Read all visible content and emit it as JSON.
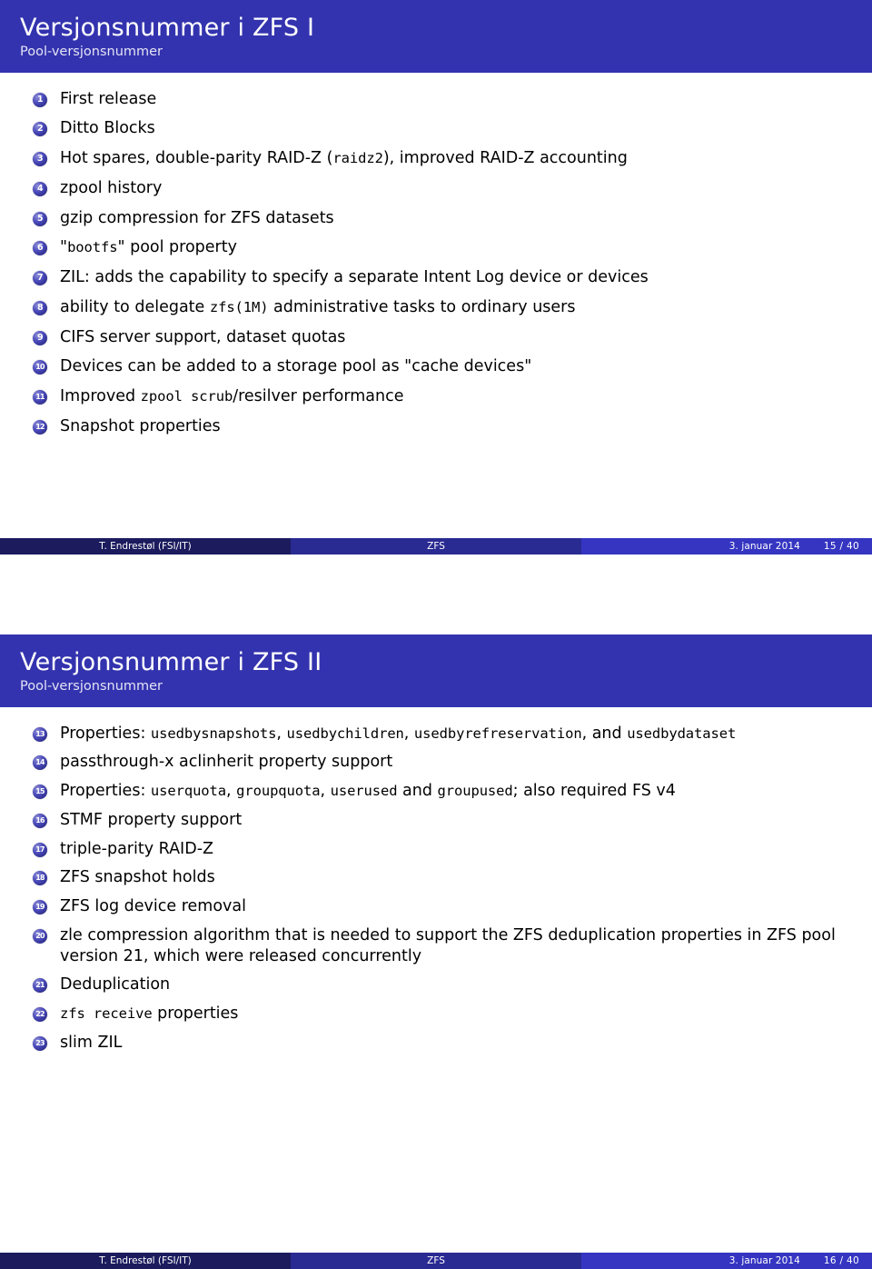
{
  "slides": [
    {
      "title": "Versjonsnummer i ZFS I",
      "subtitle": "Pool-versjonsnummer",
      "items": [
        {
          "n": "1",
          "parts": [
            {
              "t": "First release",
              "mono": false
            }
          ]
        },
        {
          "n": "2",
          "parts": [
            {
              "t": "Ditto Blocks",
              "mono": false
            }
          ]
        },
        {
          "n": "3",
          "parts": [
            {
              "t": "Hot spares, double-parity RAID-Z (",
              "mono": false
            },
            {
              "t": "raidz2",
              "mono": true
            },
            {
              "t": "), improved RAID-Z accounting",
              "mono": false
            }
          ]
        },
        {
          "n": "4",
          "parts": [
            {
              "t": "zpool history",
              "mono": false
            }
          ]
        },
        {
          "n": "5",
          "parts": [
            {
              "t": "gzip compression for ZFS datasets",
              "mono": false
            }
          ]
        },
        {
          "n": "6",
          "parts": [
            {
              "t": "\"",
              "mono": false
            },
            {
              "t": "bootfs",
              "mono": true
            },
            {
              "t": "\" pool property",
              "mono": false
            }
          ]
        },
        {
          "n": "7",
          "parts": [
            {
              "t": "ZIL: adds the capability to specify a separate Intent Log device or devices",
              "mono": false
            }
          ]
        },
        {
          "n": "8",
          "parts": [
            {
              "t": "ability to delegate ",
              "mono": false
            },
            {
              "t": "zfs(1M)",
              "mono": true
            },
            {
              "t": " administrative tasks to ordinary users",
              "mono": false
            }
          ]
        },
        {
          "n": "9",
          "parts": [
            {
              "t": "CIFS server support, dataset quotas",
              "mono": false
            }
          ]
        },
        {
          "n": "10",
          "parts": [
            {
              "t": "Devices can be added to a storage pool as \"cache devices\"",
              "mono": false
            }
          ]
        },
        {
          "n": "11",
          "parts": [
            {
              "t": "Improved ",
              "mono": false
            },
            {
              "t": "zpool scrub",
              "mono": true
            },
            {
              "t": "/resilver performance",
              "mono": false
            }
          ]
        },
        {
          "n": "12",
          "parts": [
            {
              "t": "Snapshot properties",
              "mono": false
            }
          ]
        }
      ],
      "footer": {
        "author": "T. Endrestøl  (FSI/IT)",
        "title": "ZFS",
        "date": "3. januar 2014",
        "page": "15 / 40"
      }
    },
    {
      "title": "Versjonsnummer i ZFS II",
      "subtitle": "Pool-versjonsnummer",
      "items": [
        {
          "n": "13",
          "parts": [
            {
              "t": "Properties: ",
              "mono": false
            },
            {
              "t": "usedbysnapshots",
              "mono": true
            },
            {
              "t": ", ",
              "mono": false
            },
            {
              "t": "usedbychildren",
              "mono": true
            },
            {
              "t": ", ",
              "mono": false
            },
            {
              "t": "usedbyrefreservation",
              "mono": true
            },
            {
              "t": ", and ",
              "mono": false
            },
            {
              "t": "usedbydataset",
              "mono": true
            }
          ]
        },
        {
          "n": "14",
          "parts": [
            {
              "t": "passthrough-x aclinherit property support",
              "mono": false
            }
          ]
        },
        {
          "n": "15",
          "parts": [
            {
              "t": "Properties: ",
              "mono": false
            },
            {
              "t": "userquota",
              "mono": true
            },
            {
              "t": ", ",
              "mono": false
            },
            {
              "t": "groupquota",
              "mono": true
            },
            {
              "t": ", ",
              "mono": false
            },
            {
              "t": "userused",
              "mono": true
            },
            {
              "t": " and ",
              "mono": false
            },
            {
              "t": "groupused",
              "mono": true
            },
            {
              "t": "; also required FS v4",
              "mono": false
            }
          ]
        },
        {
          "n": "16",
          "parts": [
            {
              "t": "STMF property support",
              "mono": false
            }
          ]
        },
        {
          "n": "17",
          "parts": [
            {
              "t": "triple-parity RAID-Z",
              "mono": false
            }
          ]
        },
        {
          "n": "18",
          "parts": [
            {
              "t": "ZFS snapshot holds",
              "mono": false
            }
          ]
        },
        {
          "n": "19",
          "parts": [
            {
              "t": "ZFS log device removal",
              "mono": false
            }
          ]
        },
        {
          "n": "20",
          "parts": [
            {
              "t": "zle compression algorithm that is needed to support the ZFS deduplication properties in ZFS pool version 21, which were released concurrently",
              "mono": false
            }
          ]
        },
        {
          "n": "21",
          "parts": [
            {
              "t": "Deduplication",
              "mono": false
            }
          ]
        },
        {
          "n": "22",
          "parts": [
            {
              "t": "zfs receive",
              "mono": true
            },
            {
              "t": " properties",
              "mono": false
            }
          ]
        },
        {
          "n": "23",
          "parts": [
            {
              "t": "slim ZIL",
              "mono": false
            }
          ]
        }
      ],
      "footer": {
        "author": "T. Endrestøl  (FSI/IT)",
        "title": "ZFS",
        "date": "3. januar 2014",
        "page": "16 / 40"
      }
    }
  ],
  "colors": {
    "header_blue": "#3333af",
    "footer_left": "#1b1b5e",
    "footer_mid": "#2a2a93",
    "footer_right": "#3535c2",
    "bullet_blue": "#3a3aa8"
  }
}
